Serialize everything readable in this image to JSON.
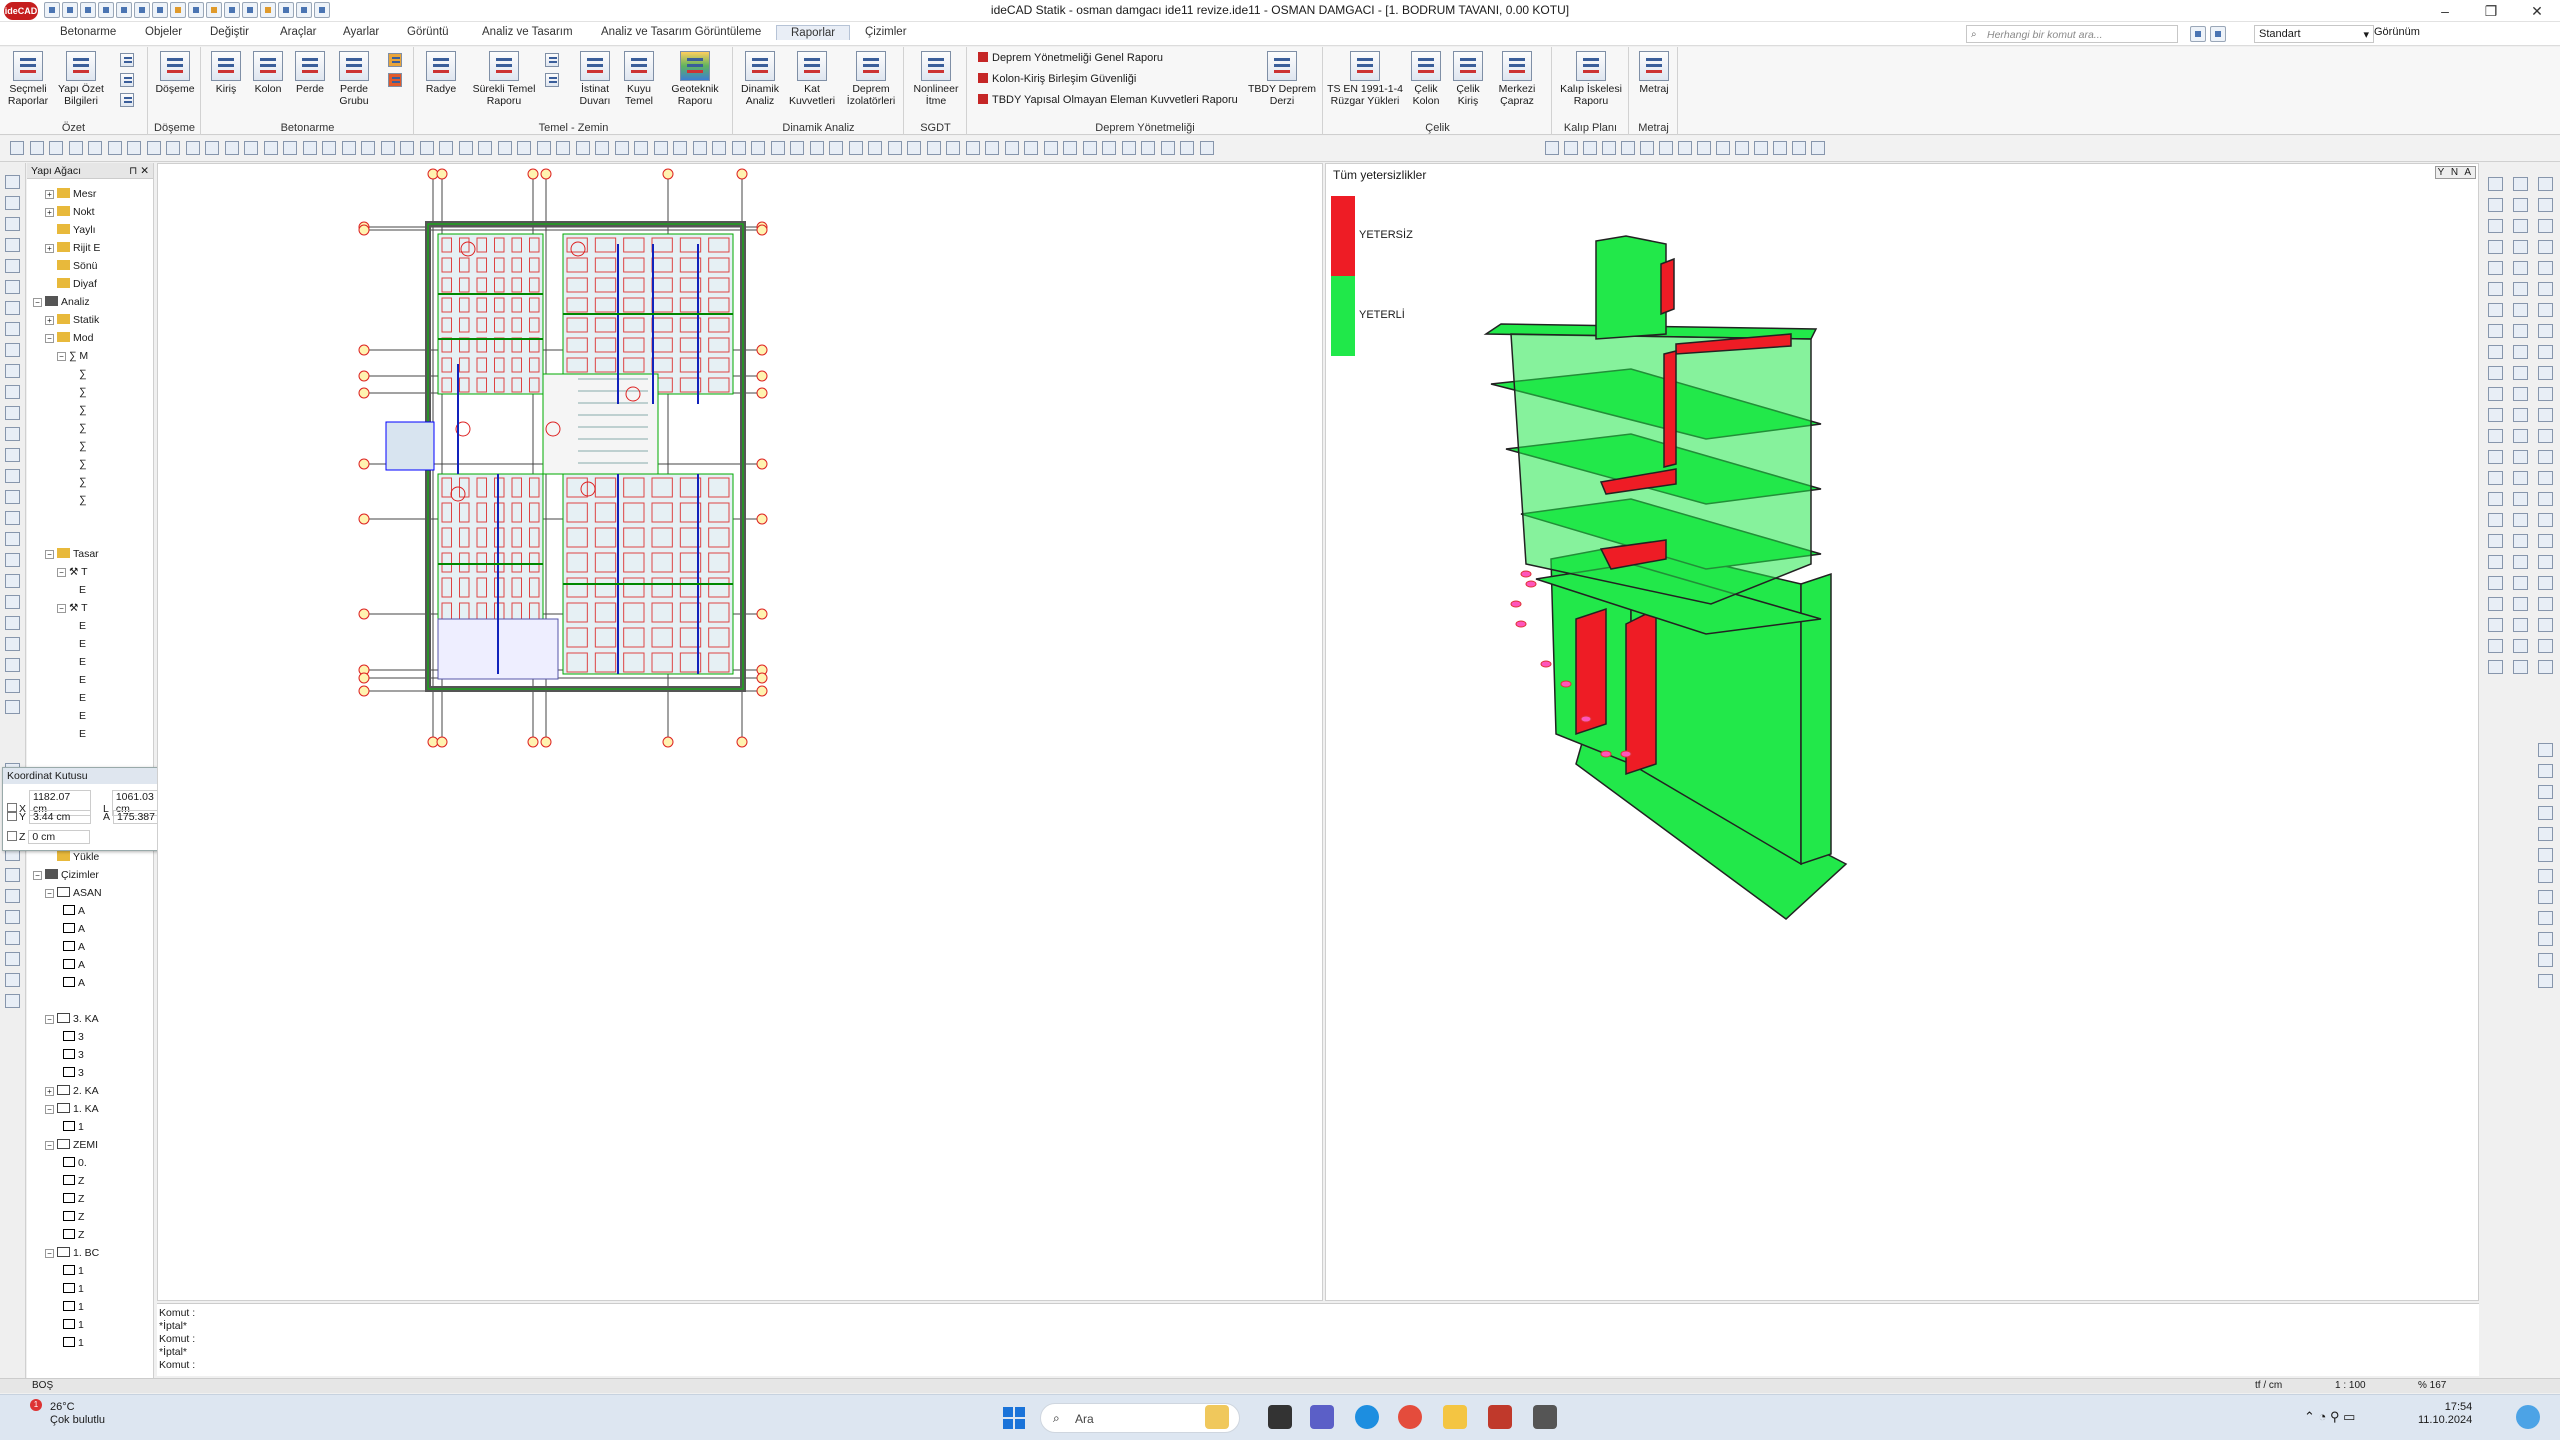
{
  "window": {
    "title": "ideCAD Statik - osman damgacı ide11 revize.ide11 - OSMAN DAMGACI - [1. BODRUM TAVANI,  0.00 KOTU]",
    "logo": "ideCAD"
  },
  "tabs": [
    "Betonarme",
    "Obje­ler",
    "Değiştir",
    "Araçlar",
    "Ayarlar",
    "Görüntü",
    "Analiz ve Tasarım",
    "Analiz ve Tasarım Görüntüleme",
    "Raporlar",
    "Çizimler"
  ],
  "search": {
    "placeholder": "Herhangi bir komut ara..."
  },
  "style_select": "Standart",
  "view_menu": "Görünüm",
  "ribbon": {
    "ozet": {
      "label": "Özet",
      "b1": "Seçmeli\nRaporlar",
      "b2": "Yapı Özet\nBilgileri"
    },
    "doseme": {
      "label": "Döşeme",
      "b1": "Döşeme"
    },
    "betonarme": {
      "label": "Betonarme",
      "b1": "Kiriş",
      "b2": "Kolon",
      "b3": "Perde",
      "b4": "Perde\nGrubu"
    },
    "temel": {
      "label": "Temel - Zemin",
      "b1": "Radye",
      "b2": "Sürekli Temel\nRaporu",
      "b3": "İstinat\nDuvarı",
      "b4": "Kuyu\nTemel",
      "b5": "Geoteknik\nRaporu"
    },
    "dinamik": {
      "label": "Dinamik Analiz",
      "b1": "Dinamik\nAnaliz",
      "b2": "Kat\nKuvvetleri",
      "b3": "Deprem\nİzolatörleri"
    },
    "sgdt": {
      "label": "SGDT",
      "b1": "Nonlineer\nİtme"
    },
    "deprem": {
      "label": "Deprem Yönetmeliği",
      "l1": "Deprem Yönetmeliği Genel Raporu",
      "l2": "Kolon-Kiriş Birleşim Güvenliği",
      "l3": "TBDY Yapısal Olmayan Eleman Kuvvetleri Raporu",
      "b1": "TBDY Deprem\nDerzi"
    },
    "celik": {
      "label": "Çelik",
      "b1": "TS EN 1991-1-4\nRüzgar Yükleri",
      "b2": "Çelik\nKolon",
      "b3": "Çelik\nKiriş",
      "b4": "Merkezi\nÇapraz"
    },
    "kalip": {
      "label": "Kalıp Planı",
      "b1": "Kalıp İskelesi\nRaporu"
    },
    "metraj": {
      "label": "Metraj",
      "b1": "Metraj"
    }
  },
  "tree": {
    "header": "Yapı Ağacı",
    "items": [
      "Mesr",
      "Nokt",
      "Yaylı",
      "Rijit E",
      "Sönü",
      "Diyaf",
      "Analiz",
      "Statik",
      "Mod",
      "Tasar",
      "Yükle",
      "Çizimler",
      "ASAN",
      "3. KA",
      "2. KA",
      "1. KA",
      "ZEMI",
      "1. BC",
      "M",
      "T",
      "T"
    ],
    "glyphs": {
      "mode_sum": "∑",
      "mode_item": "∑",
      "sub": "E",
      "draw1": "A",
      "draw2": "3",
      "draw3": "Z",
      "draw4": "1",
      "draw5": "0."
    }
  },
  "coord_box": {
    "title": "Koordinat Kutusu",
    "x_label": "X",
    "x": "1182.07 cm",
    "l_label": "L",
    "l": "1061.03 cm",
    "y_label": "Y",
    "y": "3.44 cm",
    "a_label": "A",
    "a": "175.387",
    "z_label": "Z",
    "z": "0 cm"
  },
  "legend": {
    "title": "Tüm yetersizlikler",
    "bad": "YETERSİZ",
    "good": "YETERLİ",
    "bad_color": "#ee1c25",
    "good_color": "#20e84a"
  },
  "view3d_nav": "Y N A",
  "console": {
    "lines": [
      "Komut :",
      "*İptal*",
      "Komut :",
      "*İptal*",
      "Komut :"
    ]
  },
  "status": {
    "left": "BOŞ",
    "units": "tf / cm",
    "scale": "1 : 100",
    "zoom": "% 167"
  },
  "taskbar": {
    "temp": "26°C",
    "weather": "Çok bulutlu",
    "badge": "1",
    "search": "Ara",
    "time": "17:54",
    "date": "11.10.2024"
  }
}
